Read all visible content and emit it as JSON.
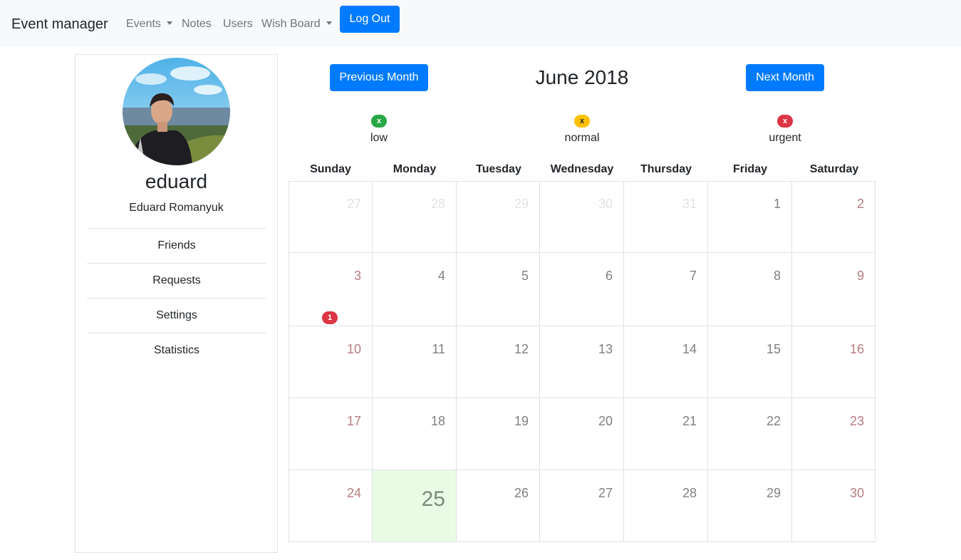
{
  "navbar": {
    "brand": "Event manager",
    "items": [
      {
        "label": "Events",
        "dropdown": true
      },
      {
        "label": "Notes",
        "dropdown": false
      },
      {
        "label": "Users",
        "dropdown": false
      },
      {
        "label": "Wish Board",
        "dropdown": true
      }
    ],
    "logout_label": "Log Out"
  },
  "sidebar": {
    "username": "eduard",
    "full_name": "Eduard Romanyuk",
    "menu": [
      "Friends",
      "Requests",
      "Settings",
      "Statistics"
    ]
  },
  "calendar": {
    "prev_label": "Previous Month",
    "next_label": "Next Month",
    "month_title": "June 2018",
    "legend": [
      {
        "glyph": "x",
        "label": "low",
        "color": "#28a745",
        "text_color": "#ffffff"
      },
      {
        "glyph": "x",
        "label": "normal",
        "color": "#ffc107",
        "text_color": "#212529"
      },
      {
        "glyph": "x",
        "label": "urgent",
        "color": "#dc3545",
        "text_color": "#ffffff"
      }
    ],
    "weekdays": [
      "Sunday",
      "Monday",
      "Tuesday",
      "Wednesday",
      "Thursday",
      "Friday",
      "Saturday"
    ],
    "weeks": [
      [
        "27",
        "28",
        "29",
        "30",
        "31",
        "1",
        "2"
      ],
      [
        "3",
        "4",
        "5",
        "6",
        "7",
        "8",
        "9"
      ],
      [
        "10",
        "11",
        "12",
        "13",
        "14",
        "15",
        "16"
      ],
      [
        "17",
        "18",
        "19",
        "20",
        "21",
        "22",
        "23"
      ],
      [
        "24",
        "25",
        "26",
        "27",
        "28",
        "29",
        "30"
      ]
    ],
    "outside_days": [
      [
        0,
        0
      ],
      [
        0,
        1
      ],
      [
        0,
        2
      ],
      [
        0,
        3
      ],
      [
        0,
        4
      ]
    ],
    "today": [
      4,
      1
    ],
    "events": [
      {
        "week": 1,
        "day": 0,
        "count": "1",
        "priority": "urgent"
      }
    ],
    "colors": {
      "primary": "#007bff",
      "today_bg": "#e9fbe5",
      "urgent": "#dc3545"
    }
  }
}
